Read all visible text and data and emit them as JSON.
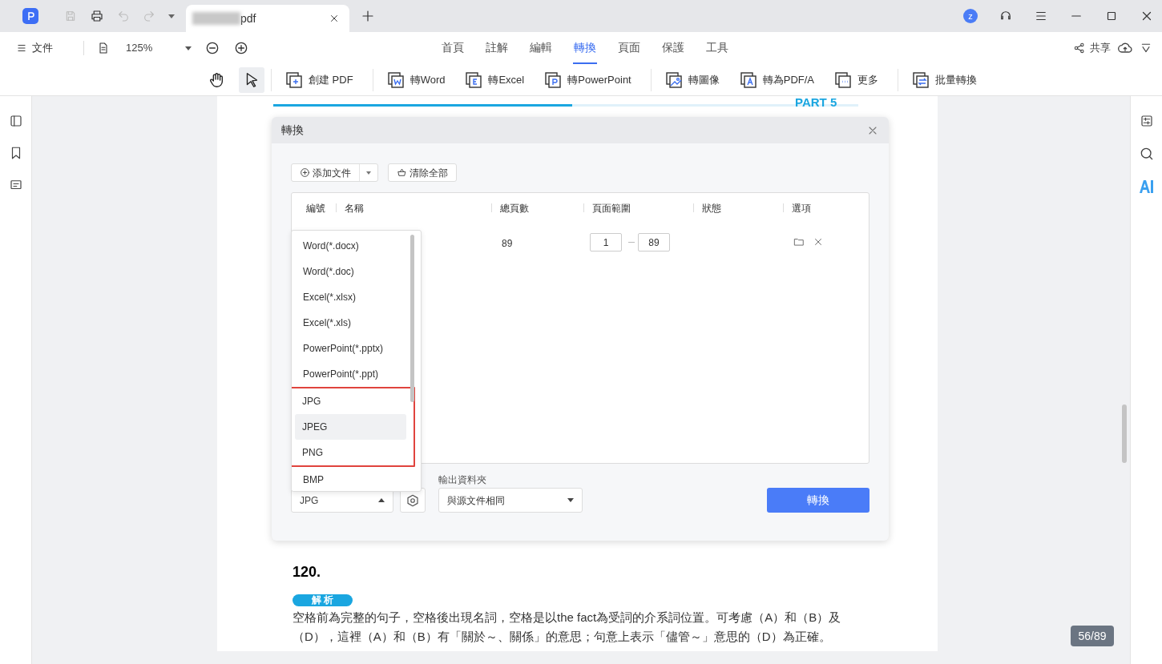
{
  "titlebar": {
    "document_tab": {
      "title": "pdf"
    },
    "avatar": "z"
  },
  "menu": {
    "file": "文件",
    "zoom": "125%",
    "share": "共享"
  },
  "tabs": [
    {
      "label": "首頁",
      "selected": false
    },
    {
      "label": "註解",
      "selected": false
    },
    {
      "label": "編輯",
      "selected": false
    },
    {
      "label": "轉換",
      "selected": true
    },
    {
      "label": "頁面",
      "selected": false
    },
    {
      "label": "保護",
      "selected": false
    },
    {
      "label": "工具",
      "selected": false
    }
  ],
  "mode_tools": [
    {
      "kind": "hand",
      "selected": false
    },
    {
      "kind": "select",
      "selected": true
    }
  ],
  "ribbon": [
    {
      "label": "創建 PDF",
      "kind": "create"
    },
    {
      "label": "轉Word",
      "kind": "word"
    },
    {
      "label": "轉Excel",
      "kind": "excel"
    },
    {
      "label": "轉PowerPoint",
      "kind": "ppt"
    },
    {
      "label": "轉圖像",
      "kind": "image"
    },
    {
      "label": "轉為PDF/A",
      "kind": "pdfa"
    },
    {
      "label": "更多",
      "kind": "more"
    },
    {
      "label": "批量轉換",
      "kind": "batch"
    }
  ],
  "document": {
    "part_label": "PART 5",
    "question": "120.",
    "badge": "解 析",
    "paragraph": "空格前為完整的句子，空格後出現名詞，空格是以the fact為受詞的介系詞位置。可考慮（A）和（B）及（D），這裡（A）和（B）有「關於～、關係」的意思；句意上表示「儘管～」意思的（D）為正確。"
  },
  "dialog": {
    "title": "轉換",
    "add_file": "添加文件",
    "clear_all": "清除全部",
    "columns": [
      "編號",
      "名稱",
      "總頁數",
      "頁面範圍",
      "狀態",
      "選項"
    ],
    "rows": [
      {
        "pages": "89",
        "range_from": "1",
        "range_to": "89"
      }
    ],
    "format_options": [
      {
        "label": "Word(*.docx)",
        "highlighted": false,
        "outlined": false
      },
      {
        "label": "Word(*.doc)",
        "highlighted": false,
        "outlined": false
      },
      {
        "label": "Excel(*.xlsx)",
        "highlighted": false,
        "outlined": false
      },
      {
        "label": "Excel(*.xls)",
        "highlighted": false,
        "outlined": false
      },
      {
        "label": "PowerPoint(*.pptx)",
        "highlighted": false,
        "outlined": false
      },
      {
        "label": "PowerPoint(*.ppt)",
        "highlighted": false,
        "outlined": false
      },
      {
        "label": "JPG",
        "highlighted": false,
        "outlined": true
      },
      {
        "label": "JPEG",
        "highlighted": true,
        "outlined": true
      },
      {
        "label": "PNG",
        "highlighted": false,
        "outlined": true
      },
      {
        "label": "BMP",
        "highlighted": false,
        "outlined": false
      }
    ],
    "format_value": "JPG",
    "output_label": "輸出資料夾",
    "output_value": "與源文件相同",
    "convert": "轉換"
  },
  "page_indicator": "56/89"
}
